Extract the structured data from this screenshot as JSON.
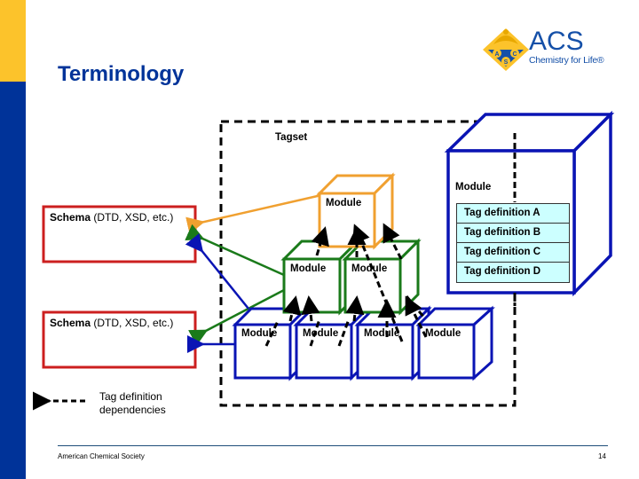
{
  "slide": {
    "title": "Terminology",
    "page_number": "14",
    "footer": "American Chemical Society"
  },
  "logo": {
    "name": "ACS",
    "tagline": "Chemistry for Life®",
    "emblem_letters": [
      "A",
      "C",
      "S"
    ]
  },
  "colors": {
    "sidebar_yellow": "#fcc32b",
    "sidebar_blue": "#003399",
    "title_blue": "#003399",
    "schema_red": "#cc1f1f",
    "module_orange": "#f0a030",
    "module_green": "#1a7a1a",
    "module_blue": "#0a14b4",
    "tagdef_fill": "#ccffff"
  },
  "diagram": {
    "tagset_label": "Tagset",
    "schemas": [
      {
        "bold": "Schema",
        "rest": " (DTD, XSD, etc.)"
      },
      {
        "bold": "Schema",
        "rest": " (DTD, XSD, etc.)"
      }
    ],
    "top_module_label": "Module",
    "mid_modules": [
      "Module",
      "Module"
    ],
    "bottom_modules": [
      "Module",
      "Module",
      "Module",
      "Module"
    ],
    "expanded_module": {
      "label": "Module",
      "tag_definitions": [
        "Tag definition A",
        "Tag definition B",
        "Tag definition C",
        "Tag definition D"
      ]
    },
    "legend": {
      "line1": "Tag definition",
      "line2": "dependencies"
    }
  }
}
